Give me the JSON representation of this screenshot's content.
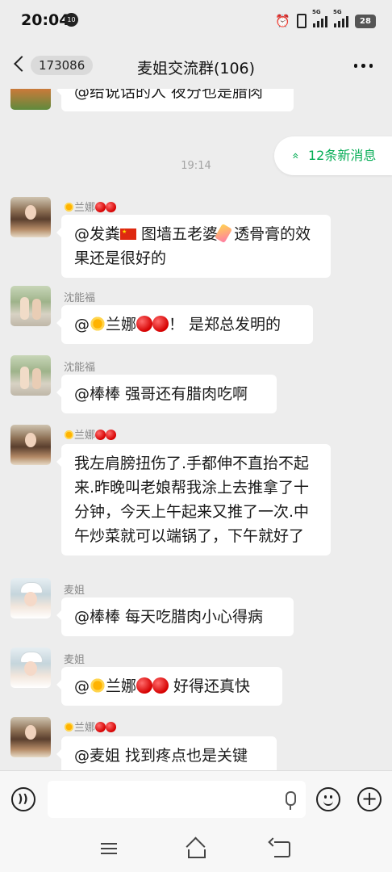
{
  "status_bar": {
    "time": "20:04",
    "notification_badge": "10",
    "network_1": "5G",
    "network_2": "5G",
    "battery": "28"
  },
  "header": {
    "unread_count": "173086",
    "title": "麦姐交流群(106)"
  },
  "banner": {
    "new_messages": "12条新消息",
    "chevron": "»"
  },
  "timestamp": "19:14",
  "messages": [
    {
      "sender": "",
      "text_before": "@给说话的人  夜分也是腊肉",
      "avatar": "top-avatar"
    },
    {
      "sender_name": "兰娜",
      "text_before": "@发粪",
      "text_middle": " 图墙五老婆",
      "text_after": " 透骨膏的效果还是很好的"
    },
    {
      "sender": "沈能福",
      "text_before": "@",
      "mention_name": "兰娜",
      "text_after": "！ 是郑总发明的"
    },
    {
      "sender": "沈能福",
      "text": "@棒棒  强哥还有腊肉吃啊"
    },
    {
      "sender_name": "兰娜",
      "text": "我左肩膀扭伤了.手都伸不直抬不起来.昨晚叫老娘帮我涂上去推拿了十分钟，今天上午起来又推了一次.中午炒菜就可以端锅了，下午就好了"
    },
    {
      "sender": "麦姐",
      "text": "@棒棒  每天吃腊肉小心得病"
    },
    {
      "sender": "麦姐",
      "text_before": "@",
      "mention_name": "兰娜",
      "text_after": "  好得还真快"
    },
    {
      "sender_name": "兰娜",
      "text": "@麦姐  找到疼点也是关键"
    }
  ],
  "colors": {
    "background": "#ededed",
    "bubble": "#ffffff",
    "accent_green": "#06ad56",
    "flag_red": "#de2910"
  },
  "icons": {
    "back": "chevron-left-icon",
    "more": "more-dots-icon",
    "voice": "voice-icon",
    "mic": "mic-icon",
    "emoji": "emoji-icon",
    "plus": "plus-icon"
  }
}
